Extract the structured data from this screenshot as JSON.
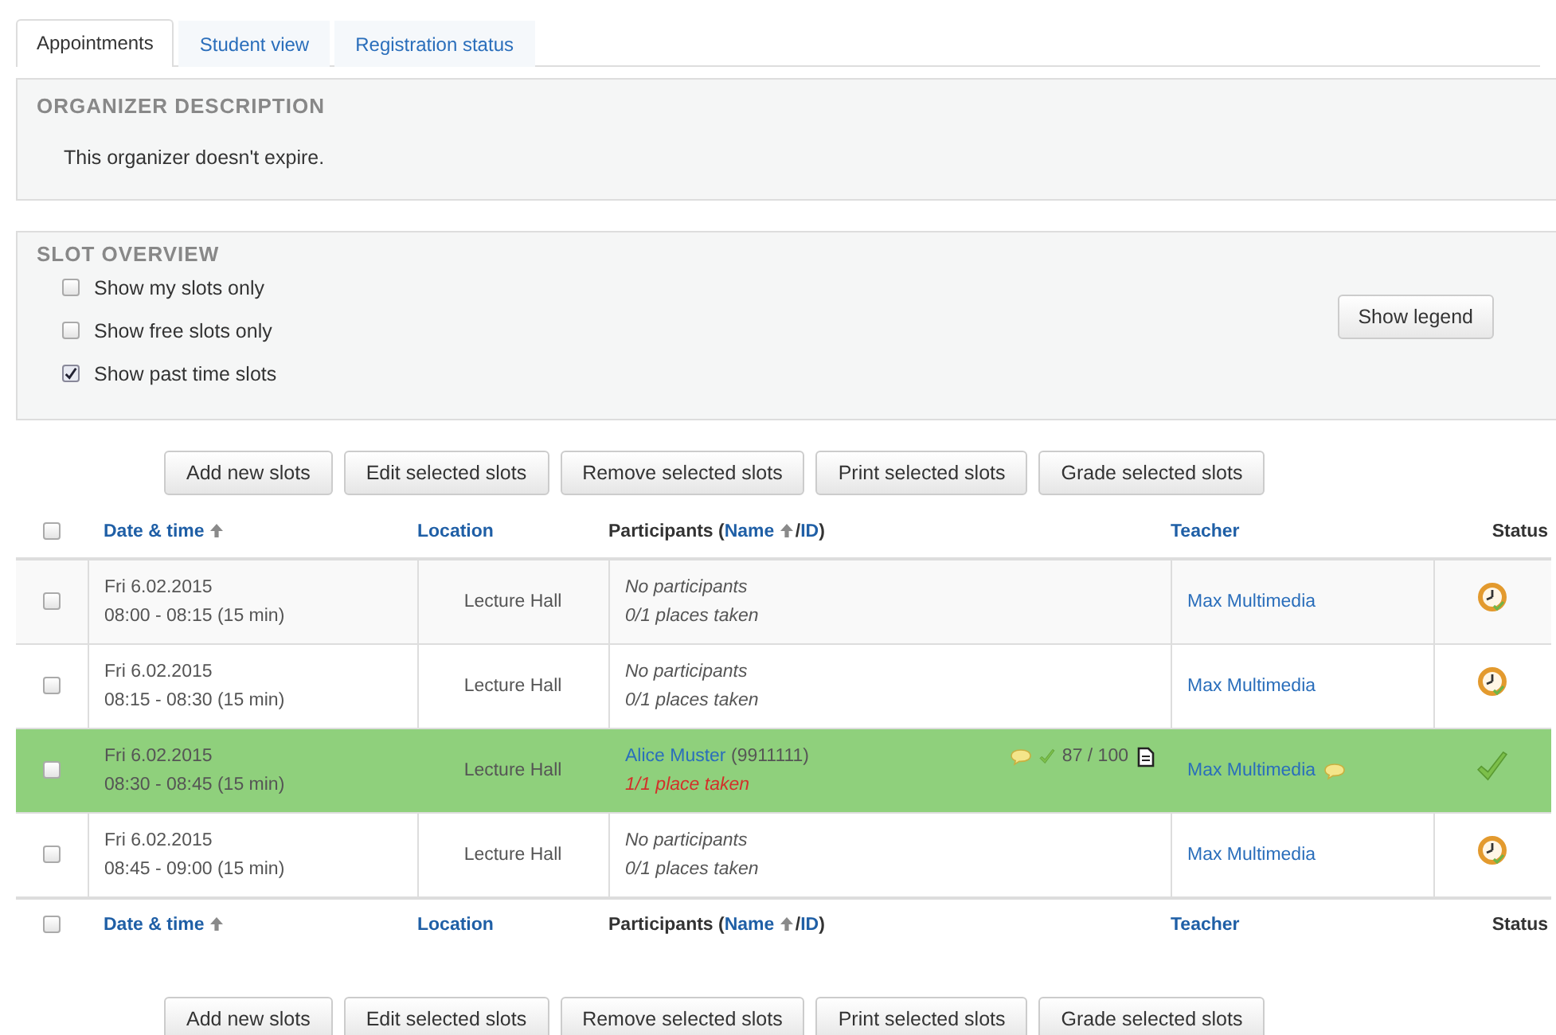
{
  "tabs": [
    {
      "label": "Appointments",
      "selected": true
    },
    {
      "label": "Student view",
      "selected": false
    },
    {
      "label": "Registration status",
      "selected": false
    }
  ],
  "organizer_description": {
    "title": "ORGANIZER DESCRIPTION",
    "text": "This organizer doesn't expire."
  },
  "slot_overview": {
    "title": "SLOT OVERVIEW",
    "options": [
      {
        "label": "Show my slots only",
        "checked": false
      },
      {
        "label": "Show free slots only",
        "checked": false
      },
      {
        "label": "Show past time slots",
        "checked": true
      }
    ],
    "legend_button": "Show legend"
  },
  "actions_top": [
    "Add new slots",
    "Edit selected slots",
    "Remove selected slots",
    "Print selected slots",
    "Grade selected slots"
  ],
  "table": {
    "header": {
      "select_all_checked": false,
      "date": "Date & time",
      "location": "Location",
      "participants_prefix": "Participants (",
      "sort_name": "Name",
      "separator": "/",
      "sort_id": "ID",
      "participants_suffix": ")",
      "teacher": "Teacher",
      "status": "Status"
    },
    "rows": [
      {
        "checked": false,
        "highlighted": false,
        "date": "Fri 6.02.2015",
        "time": "08:00 - 08:15 (15 min)",
        "location": "Lecture Hall",
        "participants": {
          "kind": "empty",
          "text": "No participants",
          "places": "0/1 places taken"
        },
        "teacher": "Max Multimedia",
        "teacher_comment": false,
        "completed": false
      },
      {
        "checked": false,
        "highlighted": false,
        "date": "Fri 6.02.2015",
        "time": "08:15 - 08:30 (15 min)",
        "location": "Lecture Hall",
        "participants": {
          "kind": "empty",
          "text": "No participants",
          "places": "0/1 places taken"
        },
        "teacher": "Max Multimedia",
        "teacher_comment": false,
        "completed": false
      },
      {
        "checked": false,
        "highlighted": true,
        "date": "Fri 6.02.2015",
        "time": "08:30 - 08:45 (15 min)",
        "location": "Lecture Hall",
        "participants": {
          "kind": "booked",
          "name": "Alice Muster",
          "id": "(9911111)",
          "comment": true,
          "attended": true,
          "grade": "87 / 100",
          "places": "1/1 place taken"
        },
        "teacher": "Max Multimedia",
        "teacher_comment": true,
        "completed": true
      },
      {
        "checked": false,
        "highlighted": false,
        "date": "Fri 6.02.2015",
        "time": "08:45 - 09:00 (15 min)",
        "location": "Lecture Hall",
        "participants": {
          "kind": "empty",
          "text": "No participants",
          "places": "0/1 places taken"
        },
        "teacher": "Max Multimedia",
        "teacher_comment": false,
        "completed": false
      }
    ],
    "footer": {
      "select_all_checked": false,
      "date": "Date & time",
      "location": "Location",
      "participants_prefix": "Participants (",
      "sort_name": "Name",
      "separator": "/",
      "sort_id": "ID",
      "participants_suffix": ")",
      "teacher": "Teacher",
      "status": "Status"
    }
  },
  "actions_bottom": [
    "Add new slots",
    "Edit selected slots",
    "Remove selected slots",
    "Print selected slots",
    "Grade selected slots"
  ]
}
